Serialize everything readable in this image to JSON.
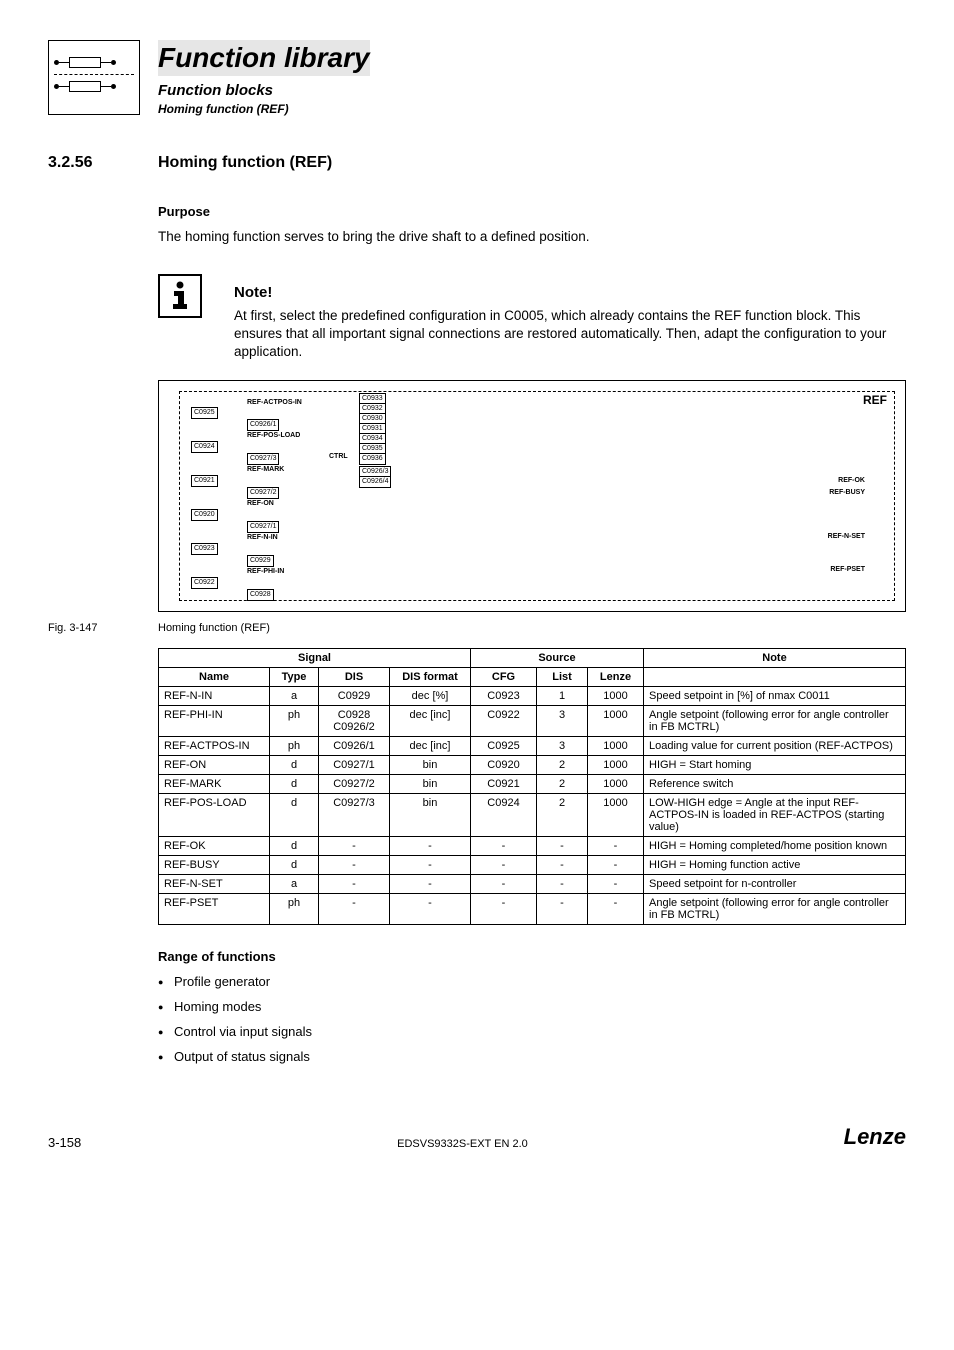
{
  "header": {
    "title": "Function library",
    "subtitle1": "Function blocks",
    "subtitle2": "Homing function (REF)"
  },
  "section": {
    "number": "3.2.56",
    "title": "Homing function (REF)"
  },
  "purpose": {
    "heading": "Purpose",
    "text": "The homing function serves to bring the drive shaft to a defined position."
  },
  "note": {
    "title": "Note!",
    "text": "At first, select the predefined configuration in C0005, which already contains the REF function block. This ensures that all important signal connections are restored automatically. Then, adapt the configuration to your application."
  },
  "diagram": {
    "ref": "REF",
    "ctrl": "CTRL",
    "inputs": [
      {
        "label": "REF-ACTPOS-IN",
        "box1": "C0925",
        "box2": "C0926/1"
      },
      {
        "label": "REF-POS-LOAD",
        "box1": "C0924",
        "box2": "C0927/3"
      },
      {
        "label": "REF-MARK",
        "box1": "C0921",
        "box2": "C0927/2"
      },
      {
        "label": "REF-ON",
        "box1": "C0920",
        "box2": "C0927/1"
      },
      {
        "label": "REF-N-IN",
        "box1": "C0923",
        "box2": "C0929"
      },
      {
        "label": "REF-PHI-IN",
        "box1": "C0922",
        "box2": "C0928"
      }
    ],
    "midboxes": [
      "C0933",
      "C0932",
      "C0930",
      "C0931",
      "C0934",
      "C0935",
      "C0936",
      "C0926/3",
      "C0926/4"
    ],
    "outputs": [
      "REF-OK",
      "REF-BUSY",
      "REF-N-SET",
      "REF-PSET"
    ]
  },
  "figure": {
    "num": "Fig. 3-147",
    "caption": "Homing function (REF)"
  },
  "table": {
    "group_headers": {
      "signal": "Signal",
      "source": "Source",
      "note": "Note"
    },
    "headers": {
      "name": "Name",
      "type": "Type",
      "dis": "DIS",
      "dis_format": "DIS format",
      "cfg": "CFG",
      "list": "List",
      "lenze": "Lenze"
    },
    "rows": [
      {
        "name": "REF-N-IN",
        "type": "a",
        "dis": "C0929",
        "disf": "dec [%]",
        "cfg": "C0923",
        "list": "1",
        "lenze": "1000",
        "note": "Speed setpoint in [%] of nmax C0011"
      },
      {
        "name": "REF-PHI-IN",
        "type": "ph",
        "dis": "C0928\nC0926/2",
        "disf": "dec [inc]",
        "cfg": "C0922",
        "list": "3",
        "lenze": "1000",
        "note": "Angle setpoint (following error for angle controller in FB MCTRL)"
      },
      {
        "name": "REF-ACTPOS-IN",
        "type": "ph",
        "dis": "C0926/1",
        "disf": "dec [inc]",
        "cfg": "C0925",
        "list": "3",
        "lenze": "1000",
        "note": "Loading value for current position (REF-ACTPOS)"
      },
      {
        "name": "REF-ON",
        "type": "d",
        "dis": "C0927/1",
        "disf": "bin",
        "cfg": "C0920",
        "list": "2",
        "lenze": "1000",
        "note": "HIGH = Start homing"
      },
      {
        "name": "REF-MARK",
        "type": "d",
        "dis": "C0927/2",
        "disf": "bin",
        "cfg": "C0921",
        "list": "2",
        "lenze": "1000",
        "note": "Reference switch"
      },
      {
        "name": "REF-POS-LOAD",
        "type": "d",
        "dis": "C0927/3",
        "disf": "bin",
        "cfg": "C0924",
        "list": "2",
        "lenze": "1000",
        "note": "LOW-HIGH edge = Angle at the input REF-ACTPOS-IN is loaded in REF-ACTPOS (starting value)"
      },
      {
        "name": "REF-OK",
        "type": "d",
        "dis": "-",
        "disf": "-",
        "cfg": "-",
        "list": "-",
        "lenze": "-",
        "note": "HIGH = Homing completed/home position known"
      },
      {
        "name": "REF-BUSY",
        "type": "d",
        "dis": "-",
        "disf": "-",
        "cfg": "-",
        "list": "-",
        "lenze": "-",
        "note": "HIGH = Homing function active"
      },
      {
        "name": "REF-N-SET",
        "type": "a",
        "dis": "-",
        "disf": "-",
        "cfg": "-",
        "list": "-",
        "lenze": "-",
        "note": "Speed setpoint for n-controller"
      },
      {
        "name": "REF-PSET",
        "type": "ph",
        "dis": "-",
        "disf": "-",
        "cfg": "-",
        "list": "-",
        "lenze": "-",
        "note": "Angle setpoint (following error for angle controller in FB MCTRL)"
      }
    ]
  },
  "range": {
    "heading": "Range of functions",
    "items": [
      "Profile generator",
      "Homing modes",
      "Control via input signals",
      "Output of status signals"
    ]
  },
  "footer": {
    "page": "3-158",
    "doc": "EDSVS9332S-EXT EN 2.0",
    "brand": "Lenze"
  }
}
